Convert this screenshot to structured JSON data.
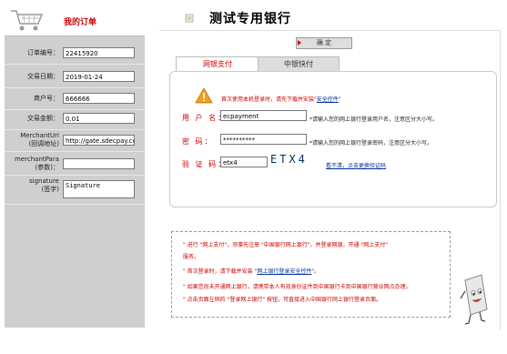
{
  "left_panel": {
    "title": "我的订单",
    "fields": [
      {
        "label": "订单编号：",
        "value": "22415920"
      },
      {
        "label": "交易日期：",
        "value": "2019-01-24"
      },
      {
        "label": "商户号：",
        "value": "666666"
      },
      {
        "label": "交易金额：",
        "value": "0.01"
      },
      {
        "label": "MerchantUrl\n(回调地址)",
        "value": "http://gate.sdecpay.com"
      },
      {
        "label": "merchantPara\n(参数)：",
        "value": ""
      },
      {
        "label": "signature\n(签字)",
        "value": "Signature"
      }
    ]
  },
  "bank": {
    "title": "测试专用银行",
    "confirm_label": "确  定",
    "tabs": [
      "网银支付",
      "中银快付"
    ],
    "warning": "首次使用本机登录时，请先下载并安装",
    "warning_link": "安全控件",
    "username_label": "用 户 名：",
    "username_value": "ecpayment",
    "username_hint": "*请输入您的网上银行登录用户名，注意区分大小写。",
    "password_label": "密    码：",
    "password_value": "**********",
    "password_hint": "*请输入您的网上银行登录密码，注意区分大小写。",
    "captcha_label": "验 证 码：",
    "captcha_value": "etx4",
    "captcha_image_text": "ETX4",
    "refresh_text": "看不清，点击更换验证码"
  },
  "notes": [
    {
      "pre": "\" 进行 \"网上支付\"，须事先注册 \"中国银行网上银行\"，并登录网银，开通 \"网上支付\"",
      "link": "",
      "post": ""
    },
    {
      "pre": "服务。",
      "link": "",
      "post": ""
    },
    {
      "pre": "\" 首次登录时，请下载并安装 \"",
      "link": "网上银行登录安全控件",
      "post": "\"。"
    },
    {
      "pre": "\" 如果您尚未开通网上银行，请携带本人有效身份证件到中国银行卡到中国银行营业网点办理。",
      "link": "",
      "post": ""
    },
    {
      "pre": "\" 点击页面左侧的 \"登录网上银行\" 按钮，可直接进入中国银行网上银行登录页面。",
      "link": "",
      "post": ""
    }
  ]
}
